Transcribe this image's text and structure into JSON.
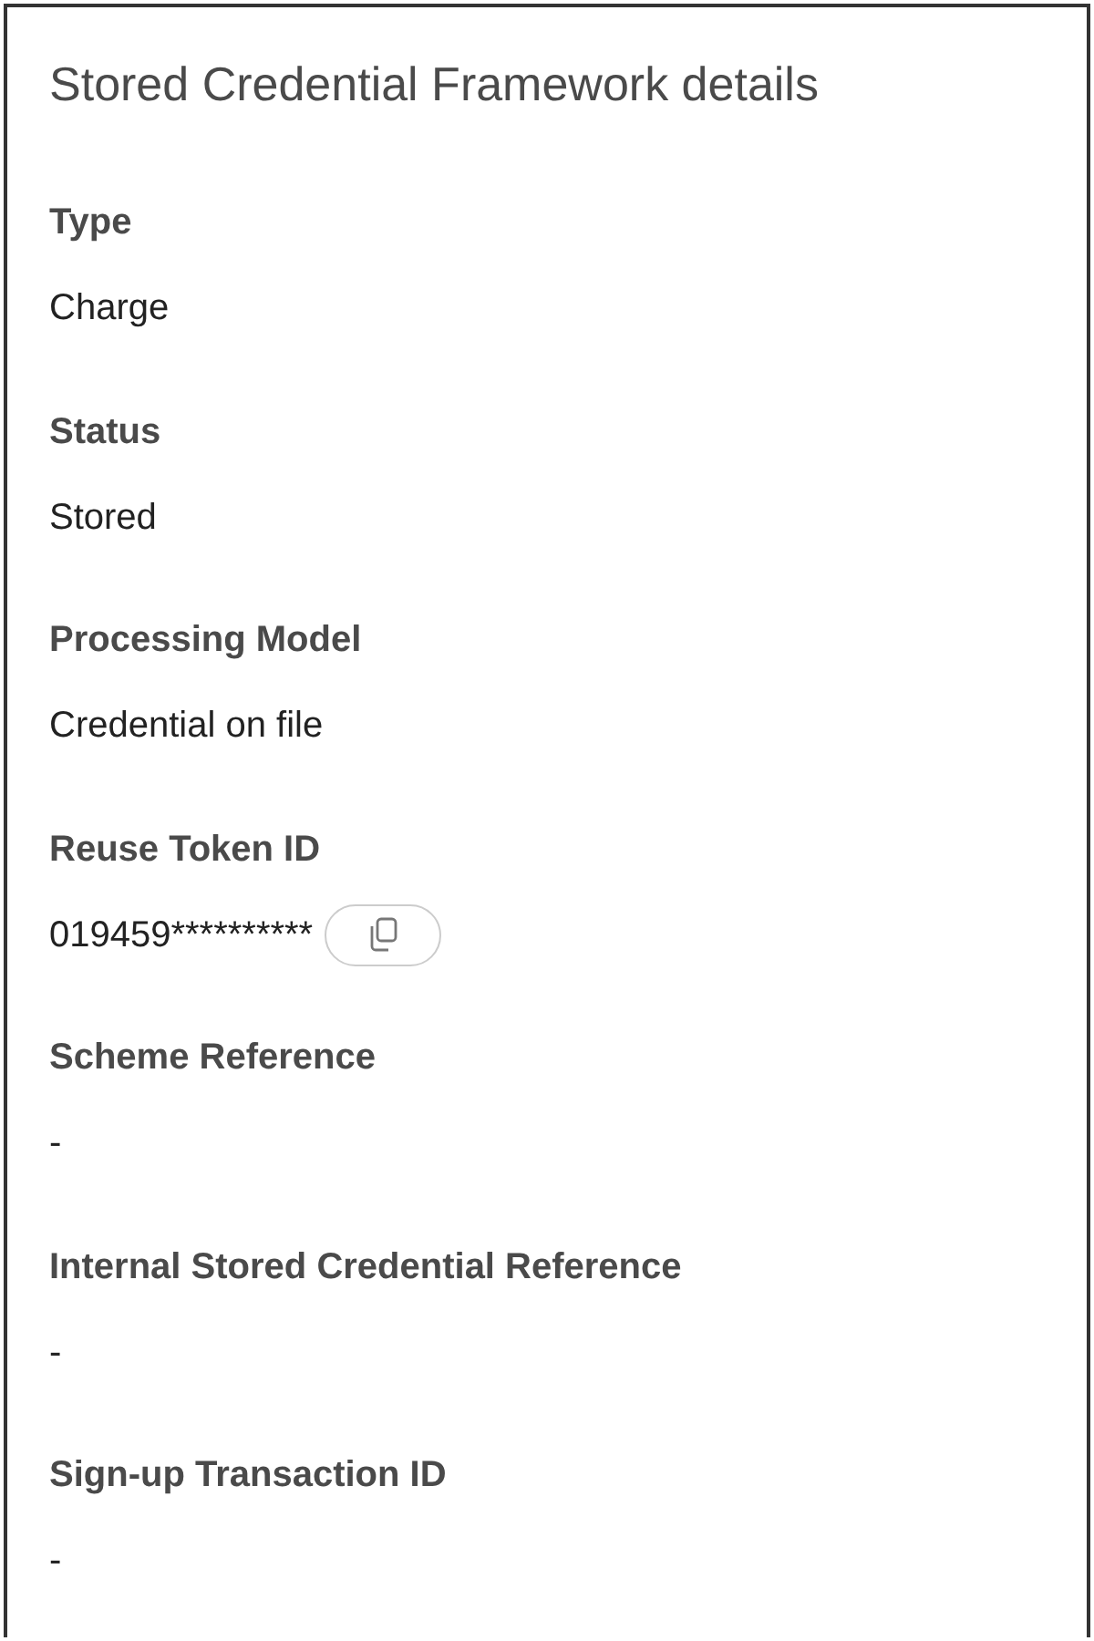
{
  "panel": {
    "title": "Stored Credential Framework details",
    "fields": [
      {
        "label": "Type",
        "value": "Charge",
        "kind": "text"
      },
      {
        "label": "Status",
        "value": "Stored",
        "kind": "text"
      },
      {
        "label": "Processing Model",
        "value": "Credential on file",
        "kind": "text"
      },
      {
        "label": "Reuse Token ID",
        "value": "019459**********",
        "kind": "copyable"
      },
      {
        "label": "Scheme Reference",
        "value": "-",
        "kind": "text"
      },
      {
        "label": "Internal Stored Credential Reference",
        "value": "-",
        "kind": "text"
      },
      {
        "label": "Sign-up Transaction ID",
        "value": "-",
        "kind": "text"
      }
    ]
  }
}
